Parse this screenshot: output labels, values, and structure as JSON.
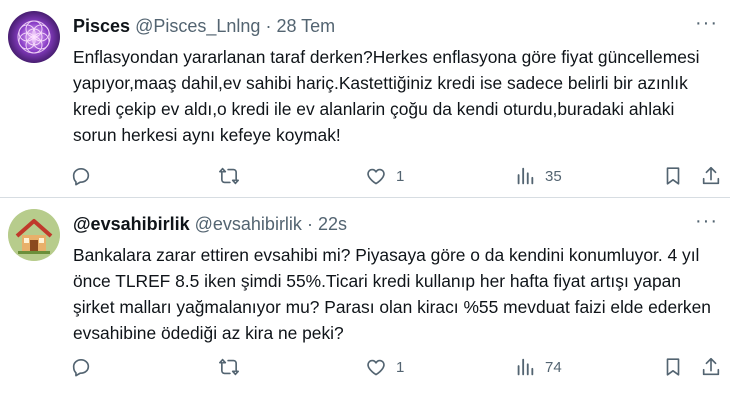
{
  "tweets": [
    {
      "display_name": "Pisces",
      "handle": "@Pisces_Lnlng",
      "separator": "·",
      "time": "28 Tem",
      "text": "Enflasyondan yararlanan taraf derken?Herkes enflasyona göre fiyat güncellemesi yapıyor,maaş dahil,ev sahibi hariç.Kastettiğiniz kredi ise sadece belirli bir azınlık kredi çekip ev aldı,o kredi ile ev alanlarin çoğu da kendi oturdu,buradaki ahlaki sorun herkesi aynı kefeye koymak!",
      "likes": "1",
      "views": "35",
      "avatar_icon": "purple-flower-of-life-avatar"
    },
    {
      "display_name": "@evsahibirlik",
      "handle": "@evsahibirlik",
      "separator": "·",
      "time": "22s",
      "text": "Bankalara zarar ettiren evsahibi mi? Piyasaya göre o da kendini konumluyor. 4 yıl önce TLREF 8.5 iken şimdi 55%.Ticari kredi kullanıp her hafta fiyat artışı yapan şirket malları yağmalanıyor mu? Parası olan kiracı %55 mevduat faizi elde ederken evsahibine ödediği az kira ne peki?",
      "likes": "1",
      "views": "74",
      "avatar_icon": "house-avatar"
    }
  ],
  "more_label": "···",
  "colors": {
    "text": "#0f1419",
    "muted": "#536471",
    "divider": "#d7dde2"
  }
}
